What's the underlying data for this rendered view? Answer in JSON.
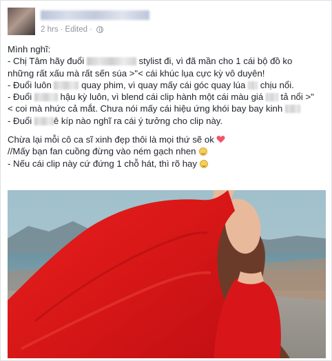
{
  "post": {
    "author_name": "",
    "timestamp": "2 hrs",
    "separator": "·",
    "edited": "Edited",
    "audience_icon": "globe-icon"
  },
  "lines": {
    "l1": "Mình nghĩ:",
    "l2a": "- Chị Tâm hãy đuổi ",
    "l2b": " stylist đi, vì đã mần cho 1 cái bộ đồ ko",
    "l3": "những rất xấu mà rất sến súa >\"< cái khúc lụa cực kỳ vô duyên!",
    "l4a": "- Đuổi luôn ",
    "l4b": " quay phim, vì quay mấy cái góc quay lúa ",
    "l4c": " chịu nổi.",
    "l5a": "- Đuổi ",
    "l5b": " hậu kỳ luôn, vì blend cái clip hành một cái màu giá ",
    "l5c": " tả nổi >\"",
    "l6a": "< coi mà nhức cả mắt. Chưa nói mấy cái hiệu ứng khói bay bay kinh ",
    "l7a": "- Đuổi ",
    "l7b": "ê kíp nào nghĩ ra cái ý tưởng cho clip này.",
    "l8": "Chừa lại mỗi cô ca sĩ xinh đẹp thôi là mọi thứ sẽ ok",
    "l9": "//Mấy bạn fan cuồng đừng vào ném gạch nhen",
    "l10": "- Nếu cái clip này cứ đứng 1 chỗ hát, thì rõ hay"
  },
  "colors": {
    "text": "#1d2129",
    "meta": "#90949c",
    "heart": "#f35369",
    "dress_red": "#e0201e"
  },
  "icons": [
    "heart-emoji-icon",
    "smile-emoji-icon",
    "grin-emoji-icon",
    "globe-icon"
  ]
}
